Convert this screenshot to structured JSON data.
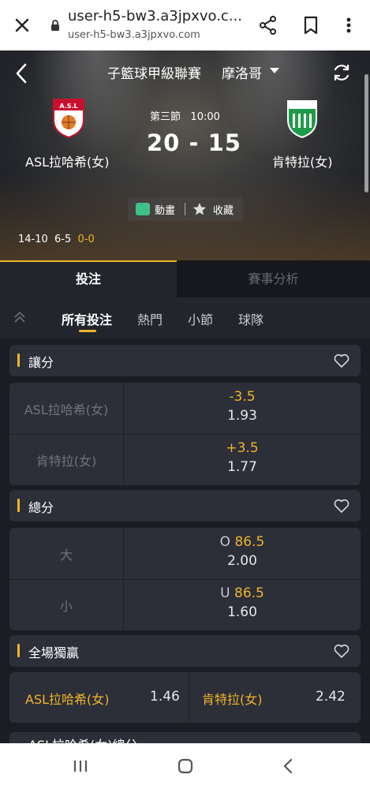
{
  "browser": {
    "title": "user-h5-bw3.a3jpxvo.c...",
    "url": "user-h5-bw3.a3jpxvo.com",
    "icons": [
      "close-icon",
      "lock-icon",
      "share-icon",
      "bookmark-icon",
      "more-vert-icon"
    ]
  },
  "header": {
    "league": "子籃球甲級聯賽",
    "region": "摩洛哥",
    "icons": [
      "back-arrow-icon",
      "caret-down-icon",
      "refresh-icon"
    ]
  },
  "match": {
    "period": "第三節",
    "clock": "10:00",
    "score": "20 - 15",
    "home_team": "ASL拉哈希(女)",
    "away_team": "肯特拉(女)",
    "home_logo_text": "A.S.L",
    "quarter_scores": [
      "14-10",
      "6-5"
    ],
    "current_quarter": "0-0"
  },
  "actions": {
    "animation_label": "動畫",
    "favorite_label": "收藏"
  },
  "tabs": {
    "bet": "投注",
    "analysis": "賽事分析"
  },
  "subtabs": [
    "所有投注",
    "熱門",
    "小節",
    "球隊"
  ],
  "handicap": {
    "title": "讓分",
    "rows": [
      {
        "team": "ASL拉哈希(女)",
        "line": "-3.5",
        "odds": "1.93"
      },
      {
        "team": "肯特拉(女)",
        "line": "+3.5",
        "odds": "1.77"
      }
    ]
  },
  "totals": {
    "title": "總分",
    "rows": [
      {
        "label": "大",
        "prefix": "O",
        "line": "86.5",
        "odds": "2.00"
      },
      {
        "label": "小",
        "prefix": "U",
        "line": "86.5",
        "odds": "1.60"
      }
    ]
  },
  "moneyline": {
    "title": "全場獨贏",
    "home": "ASL拉哈希(女)",
    "home_odds": "1.46",
    "away": "肯特拉(女)",
    "away_odds": "2.42"
  },
  "next_section": {
    "title": "ASL拉哈希(女)總分"
  },
  "colors": {
    "accent": "#f0b429",
    "card": "#2c2f38",
    "background": "#1b1d24"
  }
}
